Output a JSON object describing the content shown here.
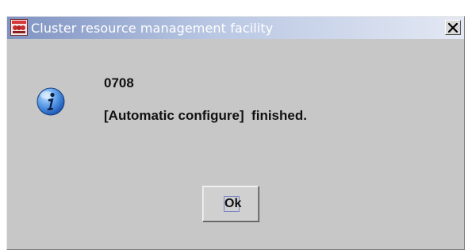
{
  "window": {
    "title": "Cluster resource management facility",
    "close_glyph": "✕"
  },
  "dialog": {
    "icon": "information-icon",
    "message_code": "0708",
    "message_text": "[Automatic configure]  finished."
  },
  "buttons": {
    "ok_label": "Ok"
  },
  "colors": {
    "titlebar_start": "#7f93c2",
    "titlebar_end": "#e3e8f3",
    "dialog_background": "#c7c7c7",
    "info_icon_blue": "#2d6fd8"
  }
}
